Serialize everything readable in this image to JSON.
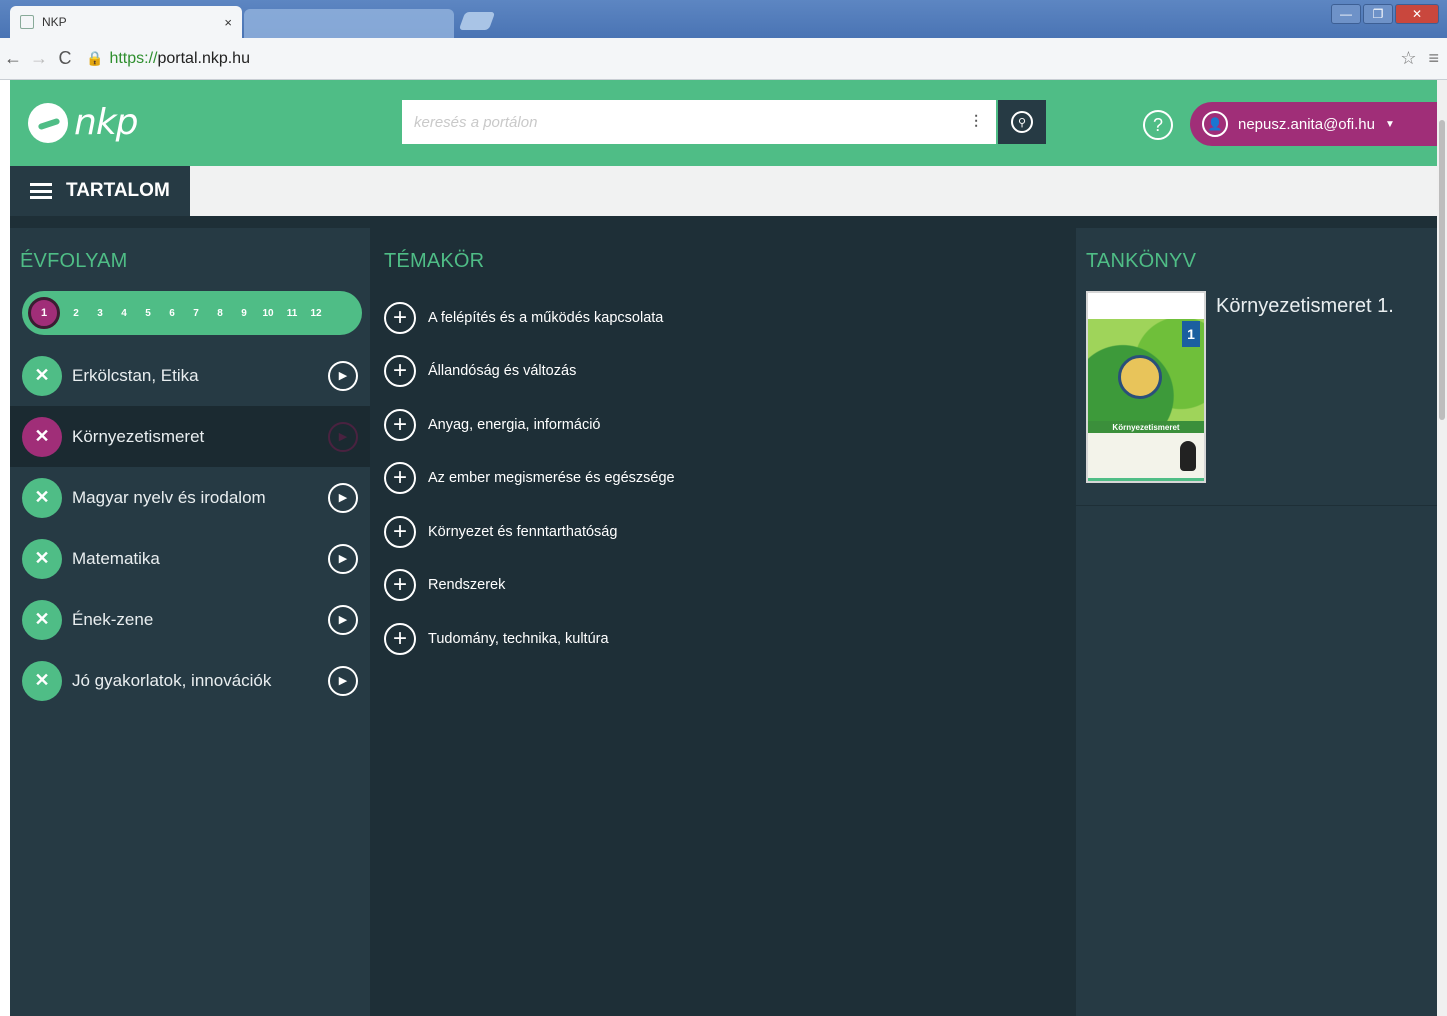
{
  "browser": {
    "tab_title": "NKP",
    "tab_close": "×",
    "url_scheme": "https://",
    "url_host": "portal.nkp.hu",
    "window_buttons": [
      "—",
      "❐",
      "✕"
    ]
  },
  "header": {
    "logo_text": "nkp",
    "search_placeholder": "keresés a portálon",
    "help_label": "?",
    "user_email": "nepusz.anita@ofi.hu",
    "brand_green": "#4fbd86",
    "accent_magenta": "#a02e78"
  },
  "subbar": {
    "menu_label": "TARTALOM"
  },
  "evfolyam": {
    "title": "ÉVFOLYAM",
    "grades": [
      "1",
      "2",
      "3",
      "4",
      "5",
      "6",
      "7",
      "8",
      "9",
      "10",
      "11",
      "12"
    ],
    "selected_grade": "1",
    "subjects": [
      {
        "label": "Erkölcstan, Etika",
        "selected": false
      },
      {
        "label": "Környezetismeret",
        "selected": true
      },
      {
        "label": "Magyar nyelv és irodalom",
        "selected": false
      },
      {
        "label": "Matematika",
        "selected": false
      },
      {
        "label": "Ének-zene",
        "selected": false
      },
      {
        "label": "Jó gyakorlatok, innovációk",
        "selected": false
      }
    ]
  },
  "temakor": {
    "title": "TÉMAKÖR",
    "topics": [
      "A felépítés és a működés kapcsolata",
      "Állandóság és változás",
      "Anyag, energia, információ",
      "Az ember megismerése és egészsége",
      "Környezet és fenntarthatóság",
      "Rendszerek",
      "Tudomány, technika, kultúra"
    ]
  },
  "tankonyv": {
    "title": "TANKÖNYV",
    "book_title": "Környezetismeret 1.",
    "cover_number": "1",
    "cover_band_text": "Környezetismeret"
  }
}
